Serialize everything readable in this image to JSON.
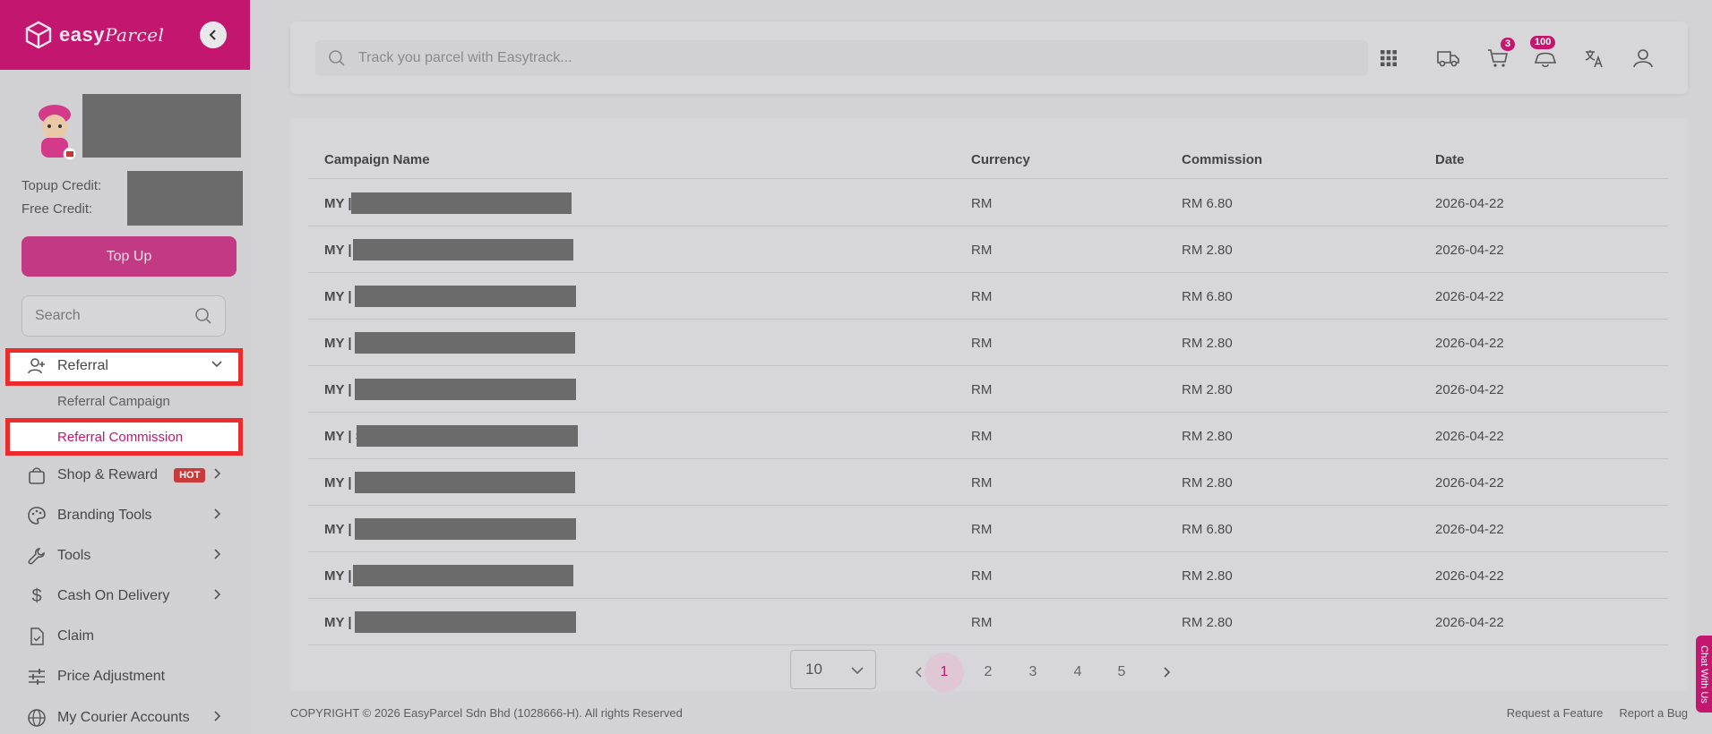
{
  "brand": {
    "name": "easy",
    "name_script": "Parcel"
  },
  "sidebar": {
    "topup_credit_label": "Topup Credit:",
    "free_credit_label": "Free Credit:",
    "topup_button": "Top Up",
    "search_placeholder": "Search",
    "items": [
      {
        "label": "Referral",
        "icon": "add-user-icon",
        "expanded": true
      },
      {
        "label": "Referral Campaign",
        "sub": true
      },
      {
        "label": "Referral Commission",
        "sub": true,
        "active": true
      },
      {
        "label": "Shop & Reward",
        "icon": "shopping-bag-icon",
        "badge": "HOT"
      },
      {
        "label": "Branding Tools",
        "icon": "palette-icon"
      },
      {
        "label": "Tools",
        "icon": "wrench-icon"
      },
      {
        "label": "Cash On Delivery",
        "icon": "dollar-icon"
      },
      {
        "label": "Claim",
        "icon": "document-check-icon"
      },
      {
        "label": "Price Adjustment",
        "icon": "sliders-icon"
      },
      {
        "label": "My Courier Accounts",
        "icon": "globe-icon"
      }
    ]
  },
  "topbar": {
    "track_placeholder": "Track you parcel with Easytrack...",
    "cart_count": "3",
    "notification_count": "100"
  },
  "table": {
    "headers": [
      "Campaign Name",
      "Currency",
      "Commission",
      "Date"
    ],
    "rows": [
      {
        "prefix": "MY |",
        "currency": "RM",
        "commission": "RM 6.80",
        "date": "2026-04-22"
      },
      {
        "prefix": "MY |",
        "currency": "RM",
        "commission": "RM 2.80",
        "date": "2026-04-22"
      },
      {
        "prefix": "MY | S",
        "currency": "RM",
        "commission": "RM 6.80",
        "date": "2026-04-22"
      },
      {
        "prefix": "MY | S",
        "currency": "RM",
        "commission": "RM 2.80",
        "date": "2026-04-22"
      },
      {
        "prefix": "MY | S",
        "currency": "RM",
        "commission": "RM 2.80",
        "date": "2026-04-22"
      },
      {
        "prefix": "MY | S",
        "currency": "RM",
        "commission": "RM 2.80",
        "date": "2026-04-22"
      },
      {
        "prefix": "MY | S",
        "currency": "RM",
        "commission": "RM 2.80",
        "date": "2026-04-22"
      },
      {
        "prefix": "MY | S",
        "currency": "RM",
        "commission": "RM 6.80",
        "date": "2026-04-22"
      },
      {
        "prefix": "MY |",
        "currency": "RM",
        "commission": "RM 2.80",
        "date": "2026-04-22"
      },
      {
        "prefix": "MY | S",
        "currency": "RM",
        "commission": "RM 2.80",
        "date": "2026-04-22"
      }
    ]
  },
  "pagination": {
    "page_size": "10",
    "pages": [
      "1",
      "2",
      "3",
      "4",
      "5"
    ],
    "current_page": "1"
  },
  "footer": {
    "copyright": "COPYRIGHT © 2026 EasyParcel Sdn Bhd (1028666-H). All rights Reserved",
    "request_feature": "Request a Feature",
    "report_bug": "Report a Bug"
  },
  "chat_tab": "Chat With Us",
  "colors": {
    "brand": "#c2166f",
    "highlight_border": "#ec2c2c"
  }
}
